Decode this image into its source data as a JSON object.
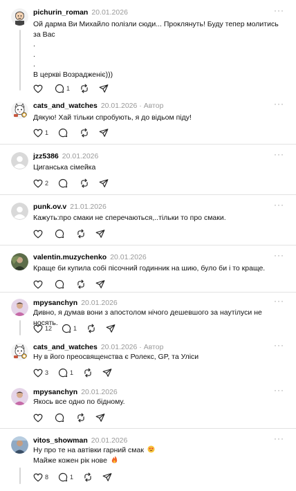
{
  "more_glyph": "···",
  "author_badge": "· Автор",
  "colors": {
    "divider": "#e2e2e2",
    "muted": "#999999",
    "thread": "#d6d6d6"
  },
  "comments": [
    {
      "username": "pichurin_roman",
      "date": "20.01.2026",
      "avatar": "cartoon-avatar-icon",
      "lines": [
        "Ой дарма Ви Михайло полізли сюди... Проклянуть! Буду тепер молитись",
        "за Вас",
        ".",
        ".",
        ".",
        "В церкві Возрадженіє)))"
      ],
      "likes": "",
      "replies": "1"
    },
    {
      "username": "cats_and_watches",
      "date": "20.01.2026",
      "is_author": true,
      "avatar": "cartoon-cat-avatar-icon",
      "lines": [
        "Дякую! Хай тільки спробують, я до відьом піду!"
      ],
      "likes": "1",
      "replies": ""
    },
    {
      "username": "jzz5386",
      "date": "20.01.2026",
      "avatar": "default-avatar-icon",
      "lines": [
        "Циганська сімейка"
      ],
      "likes": "2",
      "replies": ""
    },
    {
      "username": "punk.ov.v",
      "date": "21.01.2026",
      "avatar": "default-avatar-icon",
      "lines": [
        "Кажуть:про смаки не сперечаються,..тільки то про смаки."
      ],
      "likes": "",
      "replies": ""
    },
    {
      "username": "valentin.muzychenko",
      "date": "20.01.2026",
      "avatar": "photo-avatar-icon",
      "lines": [
        "Краще би купила собі пісочний годинник на шию, було би і то краще."
      ],
      "likes": "",
      "replies": ""
    },
    {
      "username": "mpysanchyn",
      "date": "20.01.2026",
      "avatar": "photo-avatar-icon",
      "lines": [
        "Дивно, я думав вони з апостолом нічого дешевшого за наутілуси не носять."
      ],
      "likes": "12",
      "replies": "1"
    },
    {
      "username": "cats_and_watches",
      "date": "20.01.2026",
      "is_author": true,
      "avatar": "cartoon-cat-avatar-icon",
      "lines": [
        "Ну в його преосвященства є Ролекс, GP, та Уліси"
      ],
      "likes": "3",
      "replies": "1"
    },
    {
      "username": "mpysanchyn",
      "date": "20.01.2026",
      "avatar": "photo-avatar-icon",
      "lines": [
        "Якось все одно по бідному."
      ],
      "likes": "",
      "replies": ""
    },
    {
      "username": "vitos_showman",
      "date": "20.01.2026",
      "avatar": "photo-avatar-icon",
      "lines": [
        "Ну про те на автівки гарний смак",
        "Майже кожен рік нове"
      ],
      "line_emojis": [
        "smiling-face-with-heart-eyes-icon",
        "fire-icon"
      ],
      "likes": "8",
      "replies": "1"
    }
  ]
}
